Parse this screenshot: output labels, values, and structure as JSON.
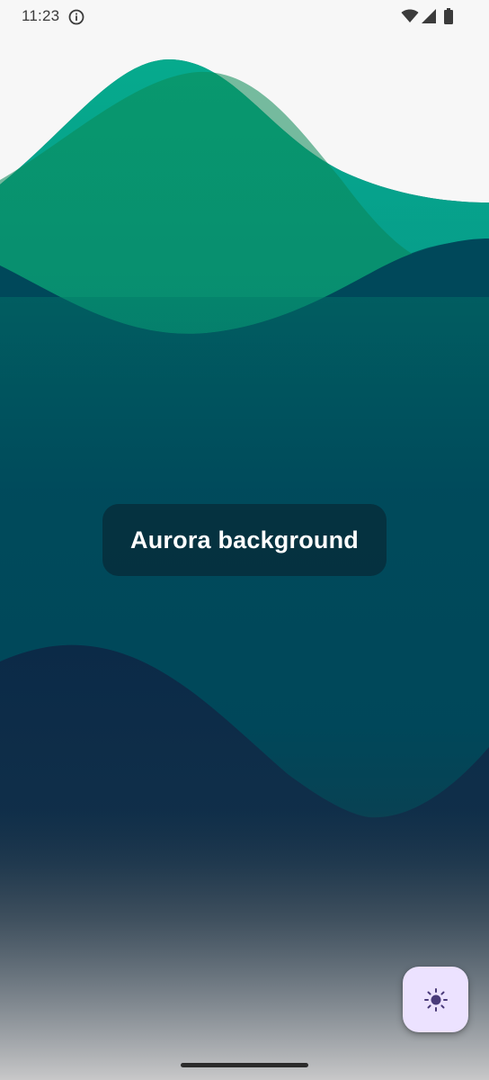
{
  "status_bar": {
    "time": "11:23",
    "icons": [
      "info-icon",
      "wifi-icon",
      "signal-icon",
      "battery-icon"
    ]
  },
  "main": {
    "title": "Aurora background"
  },
  "fab": {
    "icon": "sun-icon",
    "accent_color": "#ece2ff",
    "icon_color": "#4a3b7a"
  },
  "theme": {
    "wave_top": "#06a88a",
    "wave_deep": "#00465a",
    "wave_dark": "#0c2a45",
    "background_bottom": "#b7b7b8"
  }
}
